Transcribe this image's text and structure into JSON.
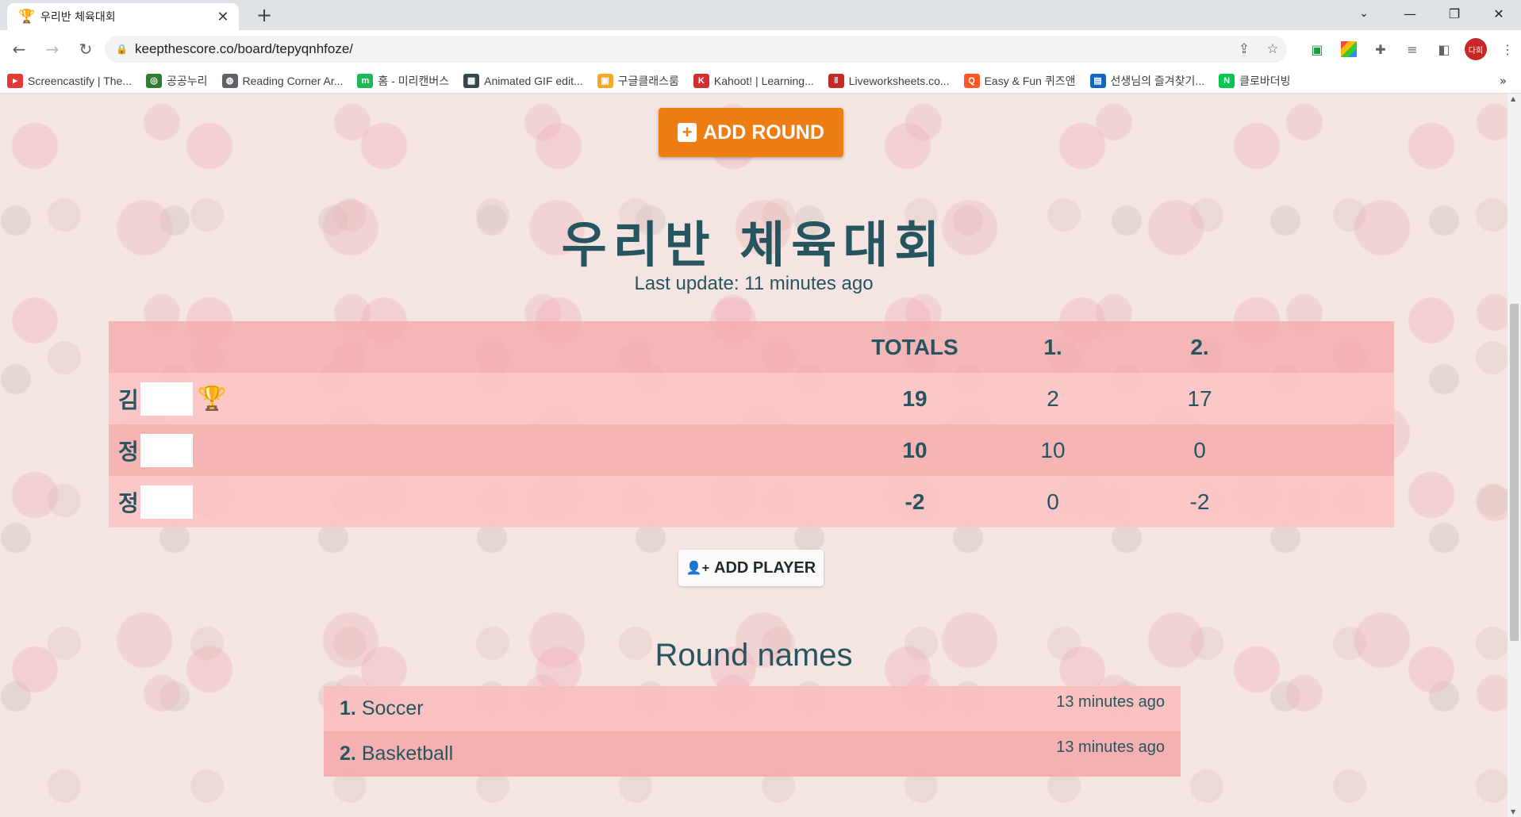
{
  "browser": {
    "tab_title": "우리반 체육대회",
    "tab_favicon": "🏆",
    "url": "keepthescore.co/board/tepyqnhfoze/",
    "profile_initials": "다희",
    "bookmarks": [
      {
        "label": "Screencastify | The...",
        "icon": "screencastify-icon",
        "color": "#e53935",
        "glyph": "▸"
      },
      {
        "label": "공공누리",
        "icon": "gonggongnuri-icon",
        "color": "#2e7d32",
        "glyph": "◎"
      },
      {
        "label": "Reading Corner Ar...",
        "icon": "globe-icon",
        "color": "#5f6368",
        "glyph": "◍"
      },
      {
        "label": "홈 - 미리캔버스",
        "icon": "miricanvas-icon",
        "color": "#1db954",
        "glyph": "m"
      },
      {
        "label": "Animated GIF edit...",
        "icon": "gif-editor-icon",
        "color": "#37474f",
        "glyph": "▦"
      },
      {
        "label": "구글클래스룸",
        "icon": "classroom-icon",
        "color": "#f9a825",
        "glyph": "▣"
      },
      {
        "label": "Kahoot! | Learning...",
        "icon": "kahoot-icon",
        "color": "#d32f2f",
        "glyph": "K"
      },
      {
        "label": "Liveworksheets.co...",
        "icon": "liveworksheets-icon",
        "color": "#c62828",
        "glyph": "ǁ"
      },
      {
        "label": "Easy & Fun 퀴즈앤",
        "icon": "quizn-icon",
        "color": "#ff5722",
        "glyph": "Q"
      },
      {
        "label": "선생님의 즐겨찾기...",
        "icon": "teacher-bookmark-icon",
        "color": "#1565c0",
        "glyph": "▤"
      },
      {
        "label": "클로바더빙",
        "icon": "clova-dubbing-icon",
        "color": "#00c853",
        "glyph": "N"
      }
    ],
    "bookmarks_more": "»"
  },
  "page": {
    "add_round_label": "ADD ROUND",
    "title": "우리반 체육대회",
    "last_update": "Last update: 11 minutes ago",
    "table": {
      "headers": {
        "totals": "TOTALS",
        "round1": "1.",
        "round2": "2."
      },
      "rows": [
        {
          "name": "김",
          "total": "19",
          "r1": "2",
          "r2": "17",
          "leader": true
        },
        {
          "name": "정",
          "total": "10",
          "r1": "10",
          "r2": "0",
          "leader": false
        },
        {
          "name": "정",
          "total": "-2",
          "r1": "0",
          "r2": "-2",
          "leader": false
        }
      ]
    },
    "add_player_label": "ADD PLAYER",
    "round_names_title": "Round names",
    "rounds": [
      {
        "num": "1.",
        "name": "Soccer",
        "time": "13 minutes ago"
      },
      {
        "num": "2.",
        "name": "Basketball",
        "time": "13 minutes ago"
      }
    ]
  },
  "colors": {
    "accent_orange": "#ee7d14",
    "text_teal": "#27555f",
    "row_pink": "#fcc4c4"
  }
}
